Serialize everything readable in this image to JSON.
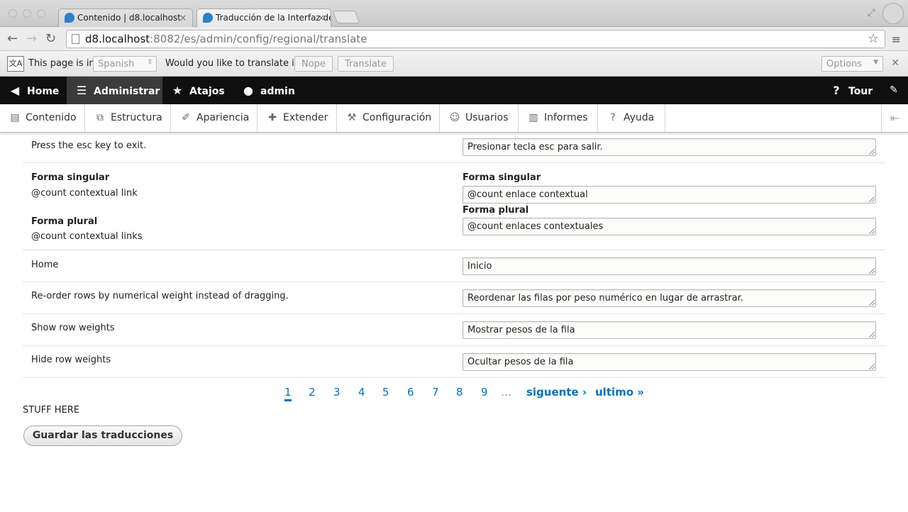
{
  "browser": {
    "tabs": [
      {
        "title": "Contenido | d8.localhost",
        "close": "×"
      },
      {
        "title": "Traducción de la Interfaz de",
        "close": "×"
      }
    ],
    "url_host": "d8.localhost",
    "url_path": ":8082/es/admin/config/regional/translate"
  },
  "translate_bar": {
    "page_is_in": "This page is in",
    "language": "Spanish",
    "question": "Would you like to translate it?",
    "nope": "Nope",
    "translate": "Translate",
    "options": "Options"
  },
  "toolbar": {
    "home": "Home",
    "administrar": "Administrar",
    "atajos": "Atajos",
    "user": "admin",
    "tour": "Tour"
  },
  "tray": {
    "items": [
      "Contenido",
      "Estructura",
      "Apariencia",
      "Extender",
      "Configuración",
      "Usuarios",
      "Informes",
      "Ayuda"
    ]
  },
  "rows": {
    "esc": {
      "source": "Press the esc key to exit.",
      "translation": "Presionar tecla esc para salir."
    },
    "plural": {
      "singular_label": "Forma singular",
      "singular_source": "@count contextual link",
      "plural_label": "Forma plural",
      "plural_source": "@count contextual links",
      "singular_translation": "@count enlace contextual",
      "plural_translation": "@count enlaces contextuales"
    },
    "home": {
      "source": "Home",
      "translation": "Inicio"
    },
    "reorder": {
      "source": "Re-order rows by numerical weight instead of dragging.",
      "translation": "Reordenar las filas por peso numérico en lugar de arrastrar."
    },
    "show": {
      "source": "Show row weights",
      "translation": "Mostrar pesos de la fila"
    },
    "hide": {
      "source": "Hide row weights",
      "translation": "Ocultar pesos de la fila"
    }
  },
  "pager": {
    "pages": [
      "1",
      "2",
      "3",
      "4",
      "5",
      "6",
      "7",
      "8",
      "9"
    ],
    "current_page": 1,
    "ellipsis": "…",
    "next": "siguente ›",
    "last": "ultimo »"
  },
  "stuff_text": "STUFF HERE",
  "save_button": "Guardar las traducciones"
}
